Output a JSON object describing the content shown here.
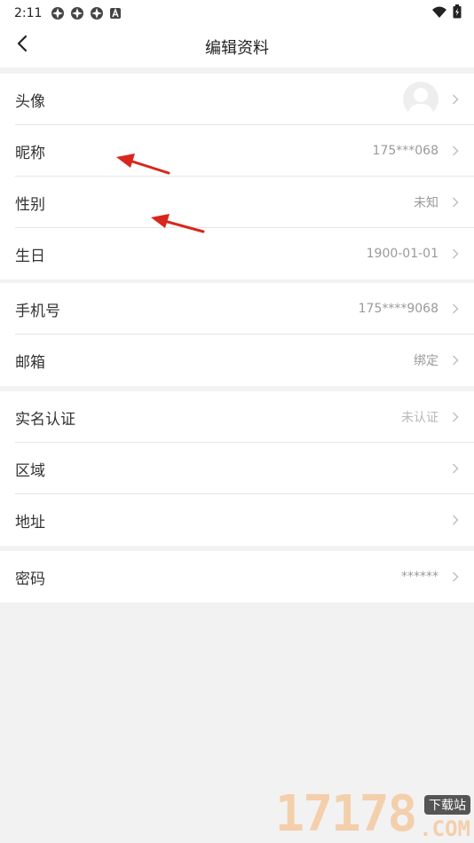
{
  "status_bar": {
    "time": "2:11",
    "left_icons": [
      "app-notification-icon",
      "app-notification-icon",
      "app-notification-icon",
      "a-notification-icon"
    ],
    "right_icons": [
      "wifi-icon",
      "battery-icon"
    ]
  },
  "nav": {
    "title": "编辑资料",
    "back_icon": "chevron-left-icon"
  },
  "groups": [
    {
      "rows": [
        {
          "label": "头像",
          "value": "",
          "type": "avatar"
        },
        {
          "label": "昵称",
          "value": "175***068"
        },
        {
          "label": "性别",
          "value": "未知"
        },
        {
          "label": "生日",
          "value": "1900-01-01"
        }
      ]
    },
    {
      "rows": [
        {
          "label": "手机号",
          "value": "175****9068"
        },
        {
          "label": "邮箱",
          "value": "绑定"
        }
      ]
    },
    {
      "rows": [
        {
          "label": "实名认证",
          "value": "未认证"
        },
        {
          "label": "区域",
          "value": ""
        },
        {
          "label": "地址",
          "value": ""
        }
      ]
    },
    {
      "rows": [
        {
          "label": "密码",
          "value": "******"
        }
      ]
    }
  ],
  "annotations": {
    "arrow_color": "#d9261c"
  },
  "watermark": {
    "number": "17178",
    "badge": "下载站",
    "domain": ".COM"
  }
}
